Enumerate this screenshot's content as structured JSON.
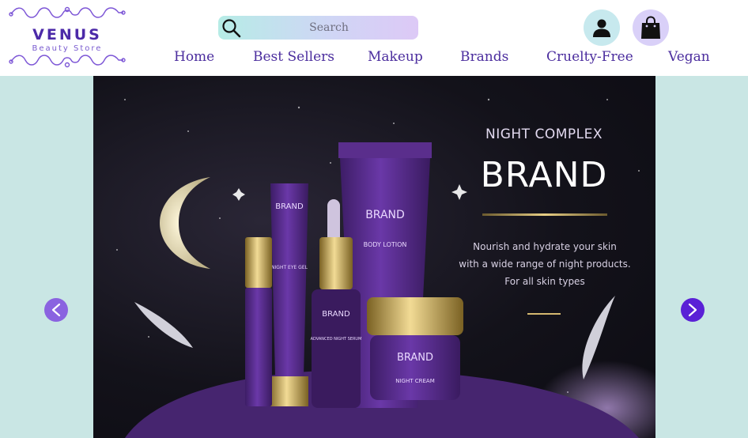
{
  "brand": {
    "name": "VENUS",
    "tagline": "Beauty Store"
  },
  "search": {
    "placeholder": "Search"
  },
  "icons": {
    "search": "search-icon",
    "account": "user-icon",
    "cart": "shopping-bag-icon",
    "prev": "chevron-left-icon",
    "next": "chevron-right-icon"
  },
  "nav": {
    "items": [
      {
        "label": "Home"
      },
      {
        "label": "Best Sellers"
      },
      {
        "label": "Makeup"
      },
      {
        "label": "Brands"
      },
      {
        "label": "Cruelty-Free"
      },
      {
        "label": "Vegan"
      }
    ]
  },
  "hero": {
    "subtitle": "NIGHT COMPLEX",
    "title": "BRAND",
    "description_lines": [
      "Nourish and hydrate your skin",
      "with a wide range of night products.",
      "For all skin types"
    ],
    "products": {
      "brand": "BRAND",
      "body_lotion": "BODY LOTION",
      "eye_gel": "NIGHT EYE GEL",
      "serum": "ADVANCED NIGHT SERUM",
      "cream": "NIGHT CREAM"
    }
  },
  "colors": {
    "accent": "#4b2d9e",
    "hero_bg": "#c9e6e4",
    "product_purple": "#5b2d8f",
    "gold": "#d4b870"
  }
}
